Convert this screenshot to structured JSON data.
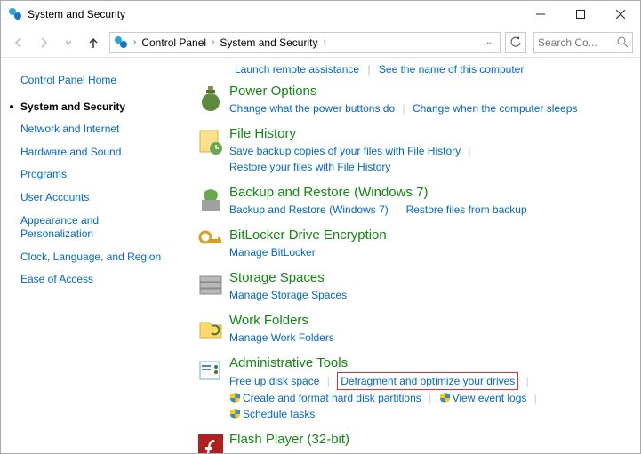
{
  "window": {
    "title": "System and Security"
  },
  "breadcrumb": {
    "root": "Control Panel",
    "current": "System and Security"
  },
  "search": {
    "placeholder": "Search Co..."
  },
  "sidebar": {
    "items": [
      {
        "label": "Control Panel Home",
        "current": false
      },
      {
        "label": "System and Security",
        "current": true
      },
      {
        "label": "Network and Internet",
        "current": false
      },
      {
        "label": "Hardware and Sound",
        "current": false
      },
      {
        "label": "Programs",
        "current": false
      },
      {
        "label": "User Accounts",
        "current": false
      },
      {
        "label": "Appearance and Personalization",
        "current": false
      },
      {
        "label": "Clock, Language, and Region",
        "current": false
      },
      {
        "label": "Ease of Access",
        "current": false
      }
    ]
  },
  "toplinks": {
    "a": "Launch remote assistance",
    "b": "See the name of this computer"
  },
  "categories": [
    {
      "title": "Power Options",
      "links": [
        {
          "text": "Change what the power buttons do"
        },
        {
          "text": "Change when the computer sleeps"
        }
      ]
    },
    {
      "title": "File History",
      "links": [
        {
          "text": "Save backup copies of your files with File History"
        },
        {
          "text": "Restore your files with File History"
        }
      ]
    },
    {
      "title": "Backup and Restore (Windows 7)",
      "links": [
        {
          "text": "Backup and Restore (Windows 7)"
        },
        {
          "text": "Restore files from backup"
        }
      ]
    },
    {
      "title": "BitLocker Drive Encryption",
      "links": [
        {
          "text": "Manage BitLocker"
        }
      ]
    },
    {
      "title": "Storage Spaces",
      "links": [
        {
          "text": "Manage Storage Spaces"
        }
      ]
    },
    {
      "title": "Work Folders",
      "links": [
        {
          "text": "Manage Work Folders"
        }
      ]
    },
    {
      "title": "Administrative Tools",
      "links": [
        {
          "text": "Free up disk space"
        },
        {
          "text": "Defragment and optimize your drives",
          "highlight": true
        },
        {
          "text": "Create and format hard disk partitions",
          "shield": true
        },
        {
          "text": "View event logs",
          "shield": true
        },
        {
          "text": "Schedule tasks",
          "shield": true
        }
      ]
    },
    {
      "title": "Flash Player (32-bit)",
      "links": []
    }
  ]
}
